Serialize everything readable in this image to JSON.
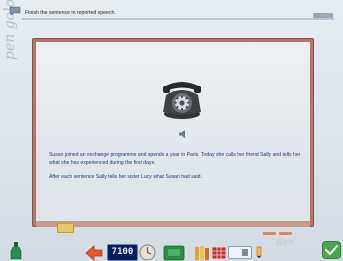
{
  "instruction": "Finish the sentence in reported speech.",
  "story": {
    "paragraph1": "Susan joined an exchange programme and spends a year in Paris. Today she calls her friend Sally and tells her what she has experienced during the first days.",
    "paragraph2": "After each sentence Sally tells her sister Lucy what Susan had said."
  },
  "toolbar": {
    "counter": "7100"
  },
  "background": {
    "scribble_left": "pen golonane.in.the",
    "signature": "Ben"
  },
  "icons": {
    "speech": "speech-bubble-icon",
    "audio": "speaker-icon",
    "phone": "telephone-illustration"
  },
  "colors": {
    "board_frame": "#b0766c",
    "story_text": "#1f3b7a",
    "counter_bg": "#0a1d5f"
  }
}
